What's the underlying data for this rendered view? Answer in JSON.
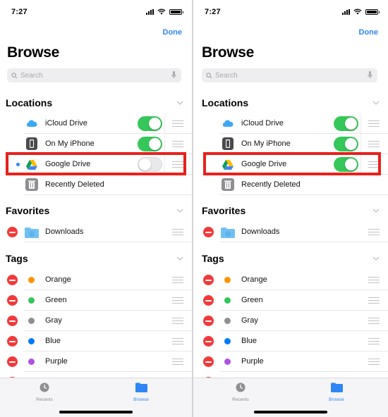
{
  "status": {
    "time": "7:27"
  },
  "nav": {
    "done": "Done"
  },
  "page": {
    "title": "Browse"
  },
  "search": {
    "placeholder": "Search"
  },
  "sections": {
    "locations": "Locations",
    "favorites": "Favorites",
    "tags": "Tags"
  },
  "locations": [
    {
      "label": "iCloud Drive",
      "icon": "icloud-icon"
    },
    {
      "label": "On My iPhone",
      "icon": "iphone-icon"
    },
    {
      "label": "Google Drive",
      "icon": "google-drive-icon"
    },
    {
      "label": "Recently Deleted",
      "icon": "trash-icon"
    }
  ],
  "toggles": {
    "left": {
      "icloud": true,
      "iphone": true,
      "google_drive": false
    },
    "right": {
      "icloud": true,
      "iphone": true,
      "google_drive": true
    }
  },
  "favorites": [
    {
      "label": "Downloads",
      "icon": "folder-icon"
    }
  ],
  "tags": [
    {
      "label": "Orange",
      "color": "#ff9500"
    },
    {
      "label": "Green",
      "color": "#34c759"
    },
    {
      "label": "Gray",
      "color": "#8e8e93"
    },
    {
      "label": "Blue",
      "color": "#007aff"
    },
    {
      "label": "Purple",
      "color": "#af52de"
    }
  ],
  "tabbar": {
    "recents": "Recents",
    "browse": "Browse"
  },
  "colors": {
    "accent": "#2f86f6",
    "toggle_on": "#35c759",
    "delete": "#f2393a",
    "highlight": "#e8211c"
  }
}
